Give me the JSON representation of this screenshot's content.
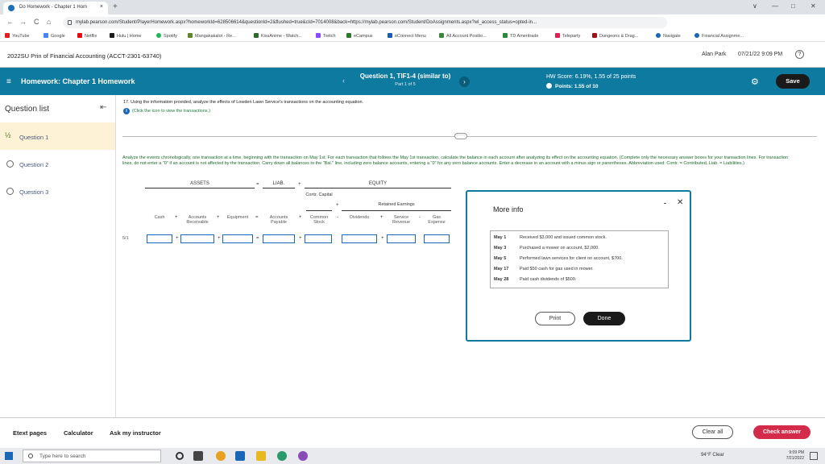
{
  "browser": {
    "tab_title": "Do Homework - Chapter 1 Hom",
    "tab_close": "×",
    "new_tab": "+",
    "url": "mylab.pearson.com/Student/PlayerHomework.aspx?homeworkId=628506614&questionId=2&flushed=true&cId=7014008&back=https://mylab.pearson.com/Student/DoAssignments.aspx?wl_access_status=opted-in...",
    "nav": {
      "back": "←",
      "forward": "→",
      "reload": "C",
      "home": "⌂"
    },
    "window_controls": {
      "collapse": "∨",
      "minimize": "—",
      "restore": "□",
      "close": "✕"
    },
    "bookmarks": [
      {
        "label": "YouTube",
        "color": "#e02020"
      },
      {
        "label": "Google",
        "color": "#4285f4"
      },
      {
        "label": "Netflix",
        "color": "#e50914"
      },
      {
        "label": "Hulu | Home",
        "color": "#1a1a1a"
      },
      {
        "label": "Spotify",
        "color": "#1db954"
      },
      {
        "label": "Mangakakalot - Re...",
        "color": "#5a8a2a"
      },
      {
        "label": "KissAnime - Watch...",
        "color": "#2a6a2a"
      },
      {
        "label": "Twitch",
        "color": "#9146ff"
      },
      {
        "label": "eCampus",
        "color": "#2a7a2a"
      },
      {
        "label": "eConnect Menu",
        "color": "#1a5ab8"
      },
      {
        "label": "All Account Positio...",
        "color": "#3a8a3a"
      },
      {
        "label": "TD Ameritrade",
        "color": "#2a8a3a"
      },
      {
        "label": "Teleparty",
        "color": "#e02050"
      },
      {
        "label": "Dungeons & Drag...",
        "color": "#a01010"
      },
      {
        "label": "Navigate",
        "color": "#1a67b8"
      },
      {
        "label": "Financial Assignme...",
        "color": "#1a67b8"
      }
    ]
  },
  "course": {
    "title": "2022SU Prin of Financial Accounting (ACCT-2301-63740)",
    "user": "Alan Park",
    "datetime": "07/21/22 9:09 PM",
    "help": "?"
  },
  "header": {
    "menu_icon": "≡",
    "homework_title": "Homework: Chapter 1 Homework",
    "prev": "‹",
    "question_title": "Question 1, TIF1-4 (similar to)",
    "part": "Part 1 of 5",
    "next": "›",
    "hw_score": "HW Score: 6.19%, 1.55 of 25 points",
    "points": "Points: 1.55 of 10",
    "settings_icon": "⚙",
    "save": "Save"
  },
  "sidebar": {
    "title": "Question list",
    "collapse_icon": "⇤",
    "partial_icon": "½",
    "items": [
      {
        "label": "Question 1"
      },
      {
        "label": "Question 2"
      },
      {
        "label": "Question 3"
      }
    ]
  },
  "content": {
    "instruction": "17. Using the information provided, analyze the effects of Lowden Lawn Service's transactions on the accounting equation.",
    "info_icon": "i",
    "click_icon": "(Click the icon to view the transactions.)",
    "dots": "·····",
    "analyze": "Analyze the events chronologically, one transaction at a time, beginning with the transaction on May 1st. For each transaction that follows the May 1st transaction, calculate the balance in each account after analyzing its effect on the accounting equation. (Complete only the necessary answer boxes for your transaction lines. For transaction lines, do not enter a \"0\" if an account is not affected by the transaction. Carry down all balances to the \"Bal.\" line, including zero balance accounts, entering a \"0\" for any zero balance accounts. Enter a decrease in an account with a minus sign or parentheses. Abbreviation used: Contr. = Contributed, Liab. = Liabilities.)",
    "groups": {
      "assets": "ASSETS",
      "liab": "LIAB.",
      "equity": "EQUITY",
      "contr_capital": "Contr. Capital",
      "retained_earnings": "Retained Earnings"
    },
    "columns": [
      "Cash",
      "Accounts Receivable",
      "Equipment",
      "Accounts Payable",
      "Common Stock",
      "Dividends",
      "Service Revenue",
      "Gas Expense"
    ],
    "operators": {
      "plus": "+",
      "minus": "-",
      "equals": "="
    },
    "row_label": "5/1"
  },
  "modal": {
    "title": "More info",
    "minimize": "-",
    "close": "✕",
    "transactions": [
      {
        "date": "May 1",
        "text": "Received $3,000 and issued common stock."
      },
      {
        "date": "May 3",
        "text": "Purchased a mower on account, $2,000."
      },
      {
        "date": "May 5",
        "text": "Performed lawn services for client on account, $700."
      },
      {
        "date": "May 17",
        "text": "Paid $50 cash for gas used in mower."
      },
      {
        "date": "May 28",
        "text": "Paid cash dividends of $500."
      }
    ],
    "print": "Print",
    "done": "Done"
  },
  "footer": {
    "etext": "Etext pages",
    "calculator": "Calculator",
    "ask": "Ask my instructor",
    "clear_all": "Clear all",
    "check_answer": "Check answer"
  },
  "taskbar": {
    "search_placeholder": "Type here to search",
    "weather": "94°F Clear",
    "time": "9:09 PM",
    "date": "7/21/2022"
  }
}
